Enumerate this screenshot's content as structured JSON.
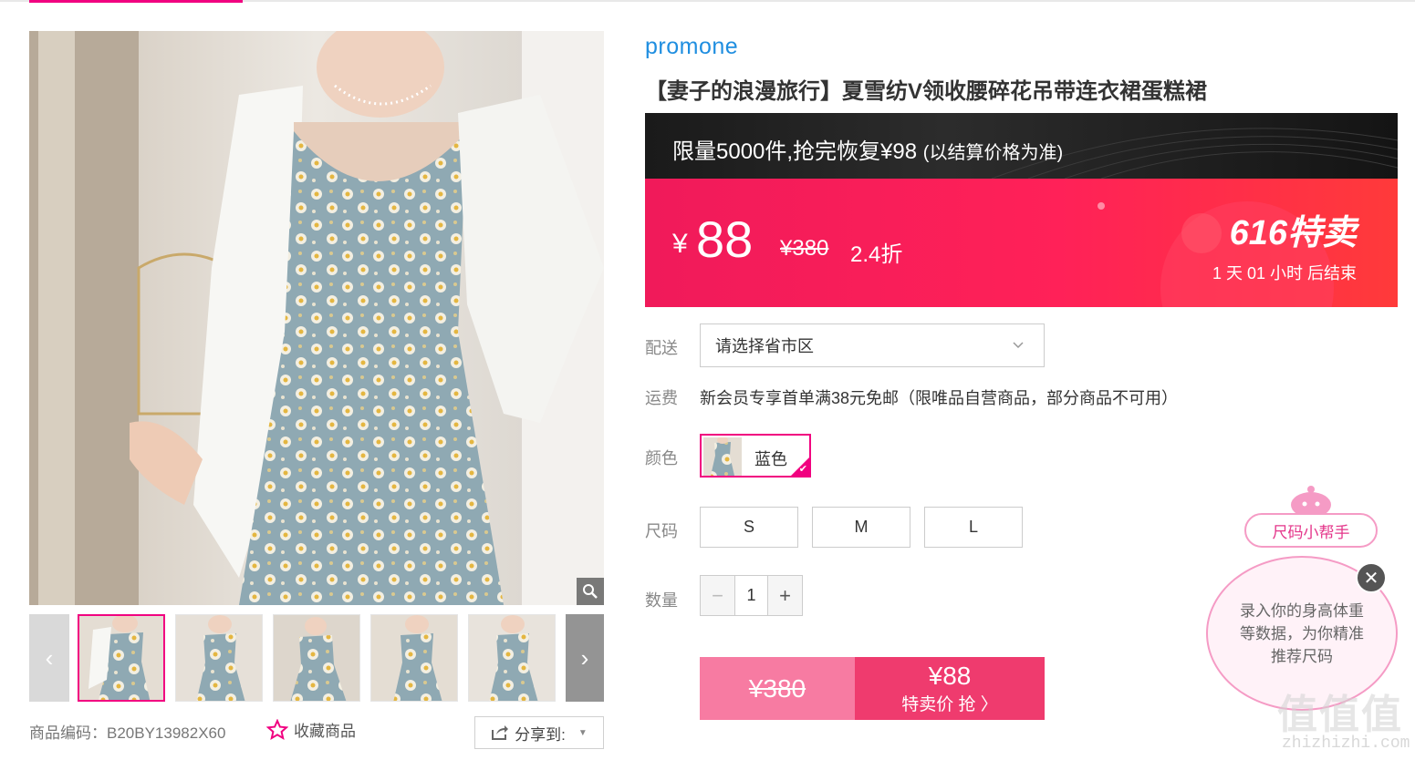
{
  "brand": "promone",
  "title": "【妻子的浪漫旅行】夏雪纺V领收腰碎花吊带连衣裙蛋糕裙",
  "limit": {
    "text": "限量5000件,抢完恢复¥98",
    "sub": "(以结算价格为准)"
  },
  "price": {
    "yen": "¥",
    "value": "88",
    "original": "¥380",
    "discount": "2.4折",
    "promo_logo": "616特卖",
    "countdown": "1 天 01 小时 后结束"
  },
  "delivery": {
    "label": "配送",
    "placeholder": "请选择省市区"
  },
  "shipping": {
    "label": "运费",
    "text": "新会员专享首单满38元免邮（限唯品自营商品，部分商品不可用）"
  },
  "color": {
    "label": "颜色",
    "option": "蓝色"
  },
  "size": {
    "label": "尺码",
    "options": [
      "S",
      "M",
      "L"
    ]
  },
  "quantity": {
    "label": "数量",
    "minus": "−",
    "value": "1",
    "plus": "+"
  },
  "buy": {
    "original": "¥380",
    "price": "¥88",
    "action": "特卖价 抢 〉"
  },
  "sku": "商品编码：B20BY13982X60",
  "favorite": "收藏商品",
  "share": "分享到:",
  "size_helper": {
    "tag": "尺码小帮手",
    "bubble": "录入你的身高体重等数据，为你精准推荐尺码",
    "close": "✕"
  },
  "watermark": {
    "text": "值值值",
    "url": "zhizhizhi.com"
  },
  "accent_color": "#f10180",
  "price_color": "#ff2158",
  "icons": [
    "zoom-icon",
    "chevron-left-icon",
    "chevron-right-icon",
    "chevron-down-icon",
    "star-icon",
    "share-icon",
    "caret-down-icon",
    "close-icon",
    "check-icon"
  ]
}
